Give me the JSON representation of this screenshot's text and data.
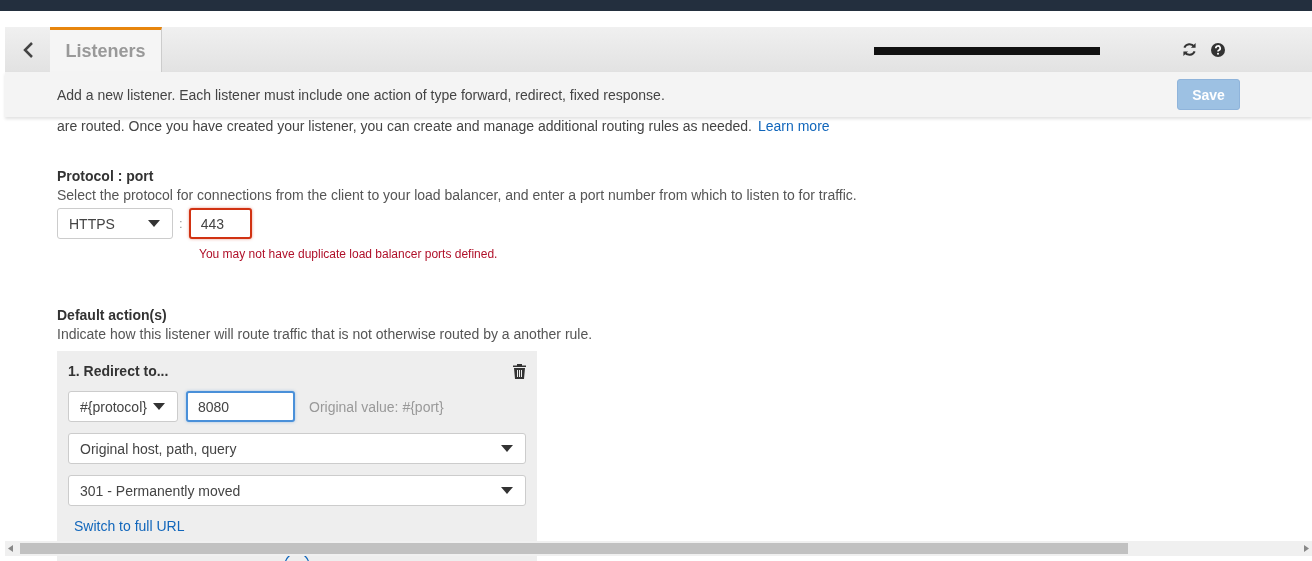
{
  "header": {
    "tab": {
      "label": "Listeners",
      "selected": true
    }
  },
  "subheader": {
    "text": "Add a new listener. Each listener must include one action of type forward, redirect, fixed response.",
    "save": {
      "label": "Save",
      "disabled": true
    }
  },
  "intro": {
    "text": "are routed. Once you have created your listener, you can create and manage additional routing rules as needed.",
    "link": "Learn more"
  },
  "protocol_port": {
    "title": "Protocol : port",
    "description": "Select the protocol for connections from the client to your load balancer, and enter a port number from which to listen to for traffic.",
    "protocol": "HTTPS",
    "separator": ":",
    "port": {
      "value": "443",
      "invalid": true
    },
    "error": "You may not have duplicate load balancer ports defined."
  },
  "default_actions": {
    "title": "Default action(s)",
    "description": "Indicate how this listener will route traffic that is not otherwise routed by a another rule.",
    "actions": [
      {
        "title": "1. Redirect to...",
        "protocol": "#{protocol}",
        "port": {
          "value": "8080",
          "focused": true
        },
        "hint": "Original value: #{port}",
        "target": "Original host, path, query",
        "status": "301 - Permanently moved",
        "link": "Switch to full URL"
      }
    ]
  }
}
